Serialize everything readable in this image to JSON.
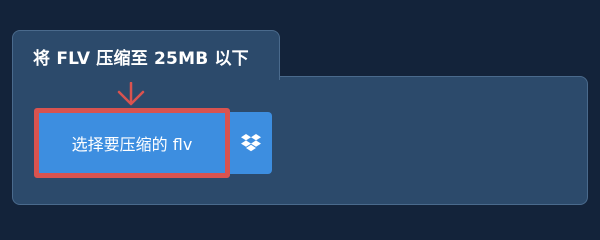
{
  "card": {
    "title": "将 FLV 压缩至 25MB 以下"
  },
  "upload": {
    "button_label": "选择要压缩的 flv",
    "secondary_icon": "dropbox-icon"
  },
  "colors": {
    "page_background": "#13233a",
    "card_background": "#2c4a6b",
    "card_border": "#4a6a8c",
    "button_blue": "#3d8ee0",
    "highlight_red": "#d9534f"
  }
}
